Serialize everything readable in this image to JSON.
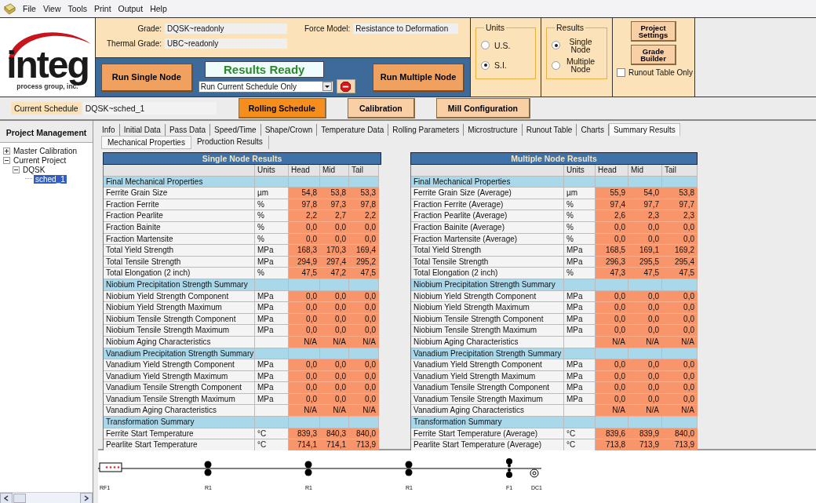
{
  "menu": [
    "File",
    "View",
    "Tools",
    "Print",
    "Output",
    "Help"
  ],
  "logo": {
    "name": "integ",
    "tagline": "process group, inc."
  },
  "grade": {
    "label": "Grade:",
    "value": "DQSK~readonly"
  },
  "thermal_grade": {
    "label": "Thermal Grade:",
    "value": "UBC~readonly"
  },
  "force_model": {
    "label": "Force Model:",
    "value": "Resistance to Deformation"
  },
  "status": "Results Ready",
  "run_single_button": "Run Single Node",
  "run_mode_dropdown": "Run Current Schedule Only",
  "run_multiple_button": "Run Multiple Node",
  "units": {
    "title": "Units",
    "options": [
      {
        "label": "U.S.",
        "selected": false
      },
      {
        "label": "S.I.",
        "selected": true
      }
    ]
  },
  "results": {
    "title": "Results",
    "options": [
      {
        "label": "Single Node",
        "selected": true
      },
      {
        "label": "Multiple Node",
        "selected": false
      }
    ]
  },
  "project_settings_button": "Project Settings",
  "grade_builder_button": "Grade Builder",
  "runout_checkbox": {
    "label": "Runout Table Only",
    "checked": false
  },
  "current_schedule": {
    "label": "Current Schedule",
    "value": "DQSK~sched_1"
  },
  "schedule_buttons": [
    {
      "label": "Rolling Schedule",
      "selected": true
    },
    {
      "label": "Calibration",
      "selected": false
    },
    {
      "label": "Mill Configuration",
      "selected": false
    }
  ],
  "sidebar": {
    "title": "Project Management",
    "tree": [
      {
        "label": "Master Calibration",
        "expanded": false,
        "selected": false
      },
      {
        "label": "Current Project",
        "expanded": true,
        "selected": false,
        "children": [
          {
            "label": "DQSK",
            "expanded": true,
            "selected": false,
            "children": [
              {
                "label": "sched_1",
                "selected": true
              }
            ]
          }
        ]
      }
    ]
  },
  "tabs": [
    {
      "label": "Info",
      "selected": false
    },
    {
      "label": "Initial Data",
      "selected": false
    },
    {
      "label": "Pass Data",
      "selected": false
    },
    {
      "label": "Speed/Time",
      "selected": false
    },
    {
      "label": "Shape/Crown",
      "selected": false
    },
    {
      "label": "Temperature Data",
      "selected": false
    },
    {
      "label": "Rolling Parameters",
      "selected": false
    },
    {
      "label": "Microstructure",
      "selected": false
    },
    {
      "label": "Runout Table",
      "selected": false
    },
    {
      "label": "Charts",
      "selected": false
    },
    {
      "label": "Summary Results",
      "selected": true
    }
  ],
  "subtabs": [
    {
      "label": "Mechanical Properties",
      "selected": true
    },
    {
      "label": "Production Results",
      "selected": false
    }
  ],
  "tables": [
    {
      "title": "Single Node Results",
      "columns": [
        "Units",
        "Head",
        "Mid",
        "Tail"
      ],
      "rows": [
        {
          "kind": "section",
          "label": "Final Mechanical Properties"
        },
        {
          "kind": "data",
          "label": "Ferrite Grain Size",
          "units": "µm",
          "values": [
            "54,8",
            "53,8",
            "53,3"
          ]
        },
        {
          "kind": "data",
          "label": "Fraction Ferrite",
          "units": "%",
          "values": [
            "97,8",
            "97,3",
            "97,8"
          ]
        },
        {
          "kind": "data",
          "label": "Fraction Pearlite",
          "units": "%",
          "values": [
            "2,2",
            "2,7",
            "2,2"
          ]
        },
        {
          "kind": "data",
          "label": "Fraction Bainite",
          "units": "%",
          "values": [
            "0,0",
            "0,0",
            "0,0"
          ]
        },
        {
          "kind": "data",
          "label": "Fraction Martensite",
          "units": "%",
          "values": [
            "0,0",
            "0,0",
            "0,0"
          ]
        },
        {
          "kind": "data",
          "label": "Total Yield Strength",
          "units": "MPa",
          "values": [
            "168,3",
            "170,3",
            "169,4"
          ]
        },
        {
          "kind": "data",
          "label": "Total Tensile Strength",
          "units": "MPa",
          "values": [
            "294,9",
            "297,4",
            "295,2"
          ]
        },
        {
          "kind": "data",
          "label": "Total Elongation (2 inch)",
          "units": "%",
          "values": [
            "47,5",
            "47,2",
            "47,5"
          ]
        },
        {
          "kind": "section",
          "label": "Niobium Precipitation Strength Summary"
        },
        {
          "kind": "data",
          "label": "Niobium Yield Strength Component",
          "units": "MPa",
          "values": [
            "0,0",
            "0,0",
            "0,0"
          ]
        },
        {
          "kind": "data",
          "label": "Niobium Yield Strength Maximum",
          "units": "MPa",
          "values": [
            "0,0",
            "0,0",
            "0,0"
          ]
        },
        {
          "kind": "data",
          "label": "Niobium Tensile Strength Component",
          "units": "MPa",
          "values": [
            "0,0",
            "0,0",
            "0,0"
          ]
        },
        {
          "kind": "data",
          "label": "Niobium Tensile Strength Maximum",
          "units": "MPa",
          "values": [
            "0,0",
            "0,0",
            "0,0"
          ]
        },
        {
          "kind": "data",
          "label": "Niobium Aging Characteristics",
          "units": "",
          "values": [
            "N/A",
            "N/A",
            "N/A"
          ]
        },
        {
          "kind": "section",
          "label": "Vanadium Precipitation Strength Summary"
        },
        {
          "kind": "data",
          "label": "Vanadium Yield Strength Component",
          "units": "MPa",
          "values": [
            "0,0",
            "0,0",
            "0,0"
          ]
        },
        {
          "kind": "data",
          "label": "Vanadium Yield Strength Maximum",
          "units": "MPa",
          "values": [
            "0,0",
            "0,0",
            "0,0"
          ]
        },
        {
          "kind": "data",
          "label": "Vanadium Tensile Strength Component",
          "units": "MPa",
          "values": [
            "0,0",
            "0,0",
            "0,0"
          ]
        },
        {
          "kind": "data",
          "label": "Vanadium Tensile Strength Maximum",
          "units": "MPa",
          "values": [
            "0,0",
            "0,0",
            "0,0"
          ]
        },
        {
          "kind": "data",
          "label": "Vanadium Aging Characteristics",
          "units": "",
          "values": [
            "N/A",
            "N/A",
            "N/A"
          ]
        },
        {
          "kind": "section",
          "label": "Transformation Summary"
        },
        {
          "kind": "data",
          "label": "Ferrite Start Temperature",
          "units": "°C",
          "values": [
            "839,3",
            "840,3",
            "840,0"
          ]
        },
        {
          "kind": "data",
          "label": "Pearlite Start Temperature",
          "units": "°C",
          "values": [
            "714,1",
            "714,1",
            "713,9"
          ]
        }
      ]
    },
    {
      "title": "Multiple Node Results",
      "columns": [
        "Units",
        "Head",
        "Mid",
        "Tail"
      ],
      "rows": [
        {
          "kind": "section",
          "label": "Final Mechanical Properties"
        },
        {
          "kind": "data",
          "label": "Ferrite Grain Size (Average)",
          "units": "µm",
          "values": [
            "55,9",
            "54,0",
            "53,8"
          ]
        },
        {
          "kind": "data",
          "label": "Fraction Ferrite (Average)",
          "units": "%",
          "values": [
            "97,4",
            "97,7",
            "97,7"
          ]
        },
        {
          "kind": "data",
          "label": "Fraction Pearlite (Average)",
          "units": "%",
          "values": [
            "2,6",
            "2,3",
            "2,3"
          ]
        },
        {
          "kind": "data",
          "label": "Fraction Bainite (Average)",
          "units": "%",
          "values": [
            "0,0",
            "0,0",
            "0,0"
          ]
        },
        {
          "kind": "data",
          "label": "Fraction Martensite (Average)",
          "units": "%",
          "values": [
            "0,0",
            "0,0",
            "0,0"
          ]
        },
        {
          "kind": "data",
          "label": "Total Yield Strength",
          "units": "MPa",
          "values": [
            "168,5",
            "169,1",
            "169,2"
          ]
        },
        {
          "kind": "data",
          "label": "Total Tensile Strength",
          "units": "MPa",
          "values": [
            "296,3",
            "295,5",
            "295,4"
          ]
        },
        {
          "kind": "data",
          "label": "Total Elongation (2 inch)",
          "units": "%",
          "values": [
            "47,3",
            "47,5",
            "47,5"
          ]
        },
        {
          "kind": "section",
          "label": "Niobium Precipitation Strength Summary"
        },
        {
          "kind": "data",
          "label": "Niobium Yield Strength Component",
          "units": "MPa",
          "values": [
            "0,0",
            "0,0",
            "0,0"
          ]
        },
        {
          "kind": "data",
          "label": "Niobium Yield Strength Maximum",
          "units": "MPa",
          "values": [
            "0,0",
            "0,0",
            "0,0"
          ]
        },
        {
          "kind": "data",
          "label": "Niobium Tensile Strength Component",
          "units": "MPa",
          "values": [
            "0,0",
            "0,0",
            "0,0"
          ]
        },
        {
          "kind": "data",
          "label": "Niobium Tensile Strength Maximum",
          "units": "MPa",
          "values": [
            "0,0",
            "0,0",
            "0,0"
          ]
        },
        {
          "kind": "data",
          "label": "Niobium Aging Characteristics",
          "units": "",
          "values": [
            "N/A",
            "N/A",
            "N/A"
          ]
        },
        {
          "kind": "section",
          "label": "Vanadium Precipitation Strength Summary"
        },
        {
          "kind": "data",
          "label": "Vanadium Yield Strength Component",
          "units": "MPa",
          "values": [
            "0,0",
            "0,0",
            "0,0"
          ]
        },
        {
          "kind": "data",
          "label": "Vanadium Yield Strength Maximum",
          "units": "MPa",
          "values": [
            "0,0",
            "0,0",
            "0,0"
          ]
        },
        {
          "kind": "data",
          "label": "Vanadium Tensile Strength Component",
          "units": "MPa",
          "values": [
            "0,0",
            "0,0",
            "0,0"
          ]
        },
        {
          "kind": "data",
          "label": "Vanadium Tensile Strength Maximum",
          "units": "MPa",
          "values": [
            "0,0",
            "0,0",
            "0,0"
          ]
        },
        {
          "kind": "data",
          "label": "Vanadium Aging Characteristics",
          "units": "",
          "values": [
            "N/A",
            "N/A",
            "N/A"
          ]
        },
        {
          "kind": "section",
          "label": "Transformation Summary"
        },
        {
          "kind": "data",
          "label": "Ferrite Start Temperature (Average)",
          "units": "°C",
          "values": [
            "839,6",
            "839,9",
            "840,0"
          ]
        },
        {
          "kind": "data",
          "label": "Pearlite Start Temperature (Average)",
          "units": "°C",
          "values": [
            "713,8",
            "713,9",
            "713,9"
          ]
        }
      ]
    }
  ],
  "mill_layout": [
    {
      "label": "RF1",
      "kind": "furnace"
    },
    {
      "label": "R1",
      "kind": "roughing"
    },
    {
      "label": "R1",
      "kind": "roughing"
    },
    {
      "label": "R1",
      "kind": "roughing"
    },
    {
      "label": "F1",
      "kind": "finishing"
    },
    {
      "label": "DC1",
      "kind": "coiler"
    }
  ]
}
